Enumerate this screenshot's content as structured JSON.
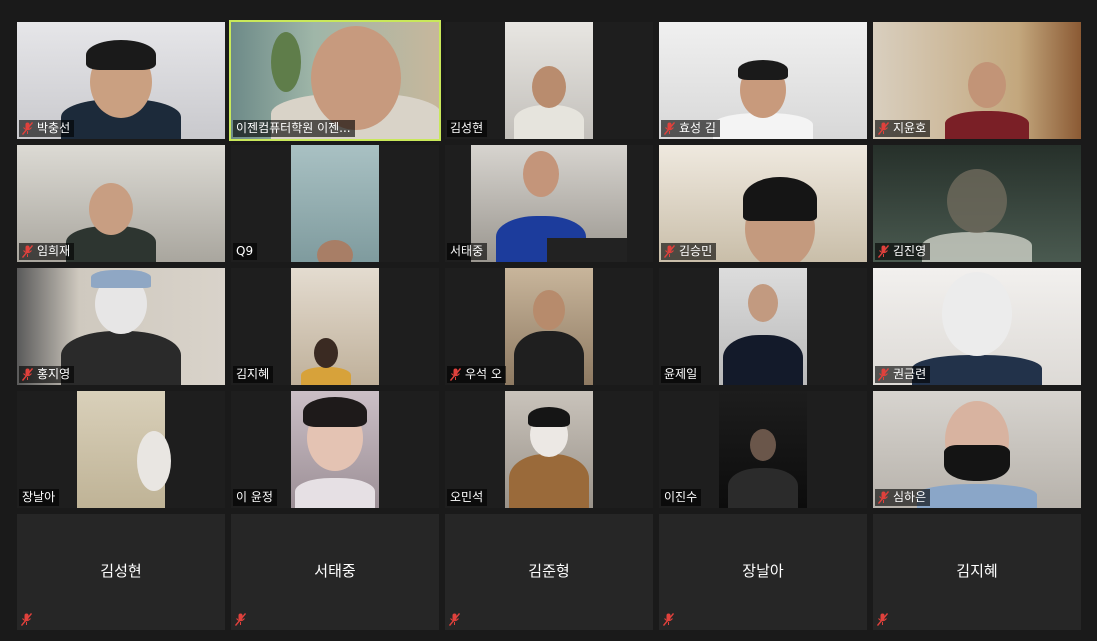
{
  "accent": "#c9e85a",
  "muted_icon_color": "#e0413c",
  "participants": [
    {
      "name": "박충선",
      "muted": true
    },
    {
      "name": "이젠컴퓨터학원 이젠...",
      "muted": false,
      "active_speaker": true
    },
    {
      "name": "김성현",
      "muted": false
    },
    {
      "name": "효성 김",
      "muted": true
    },
    {
      "name": "지윤호",
      "muted": true
    },
    {
      "name": "임희재",
      "muted": true
    },
    {
      "name": "Q9",
      "muted": false
    },
    {
      "name": "서태중",
      "muted": false
    },
    {
      "name": "김승민",
      "muted": true
    },
    {
      "name": "김진영",
      "muted": true
    },
    {
      "name": "홍지영",
      "muted": true
    },
    {
      "name": "김지혜",
      "muted": false
    },
    {
      "name": "우석 오",
      "muted": true
    },
    {
      "name": "윤제일",
      "muted": false
    },
    {
      "name": "권금련",
      "muted": true
    },
    {
      "name": "장날아",
      "muted": false
    },
    {
      "name": "이 윤정",
      "muted": false
    },
    {
      "name": "오민석",
      "muted": false
    },
    {
      "name": "이진수",
      "muted": false
    },
    {
      "name": "심하은",
      "muted": true
    }
  ],
  "no_video": [
    {
      "name": "김성현",
      "muted": true
    },
    {
      "name": "서태중",
      "muted": true
    },
    {
      "name": "김준형",
      "muted": true
    },
    {
      "name": "장날아",
      "muted": true
    },
    {
      "name": "김지혜",
      "muted": true
    }
  ]
}
